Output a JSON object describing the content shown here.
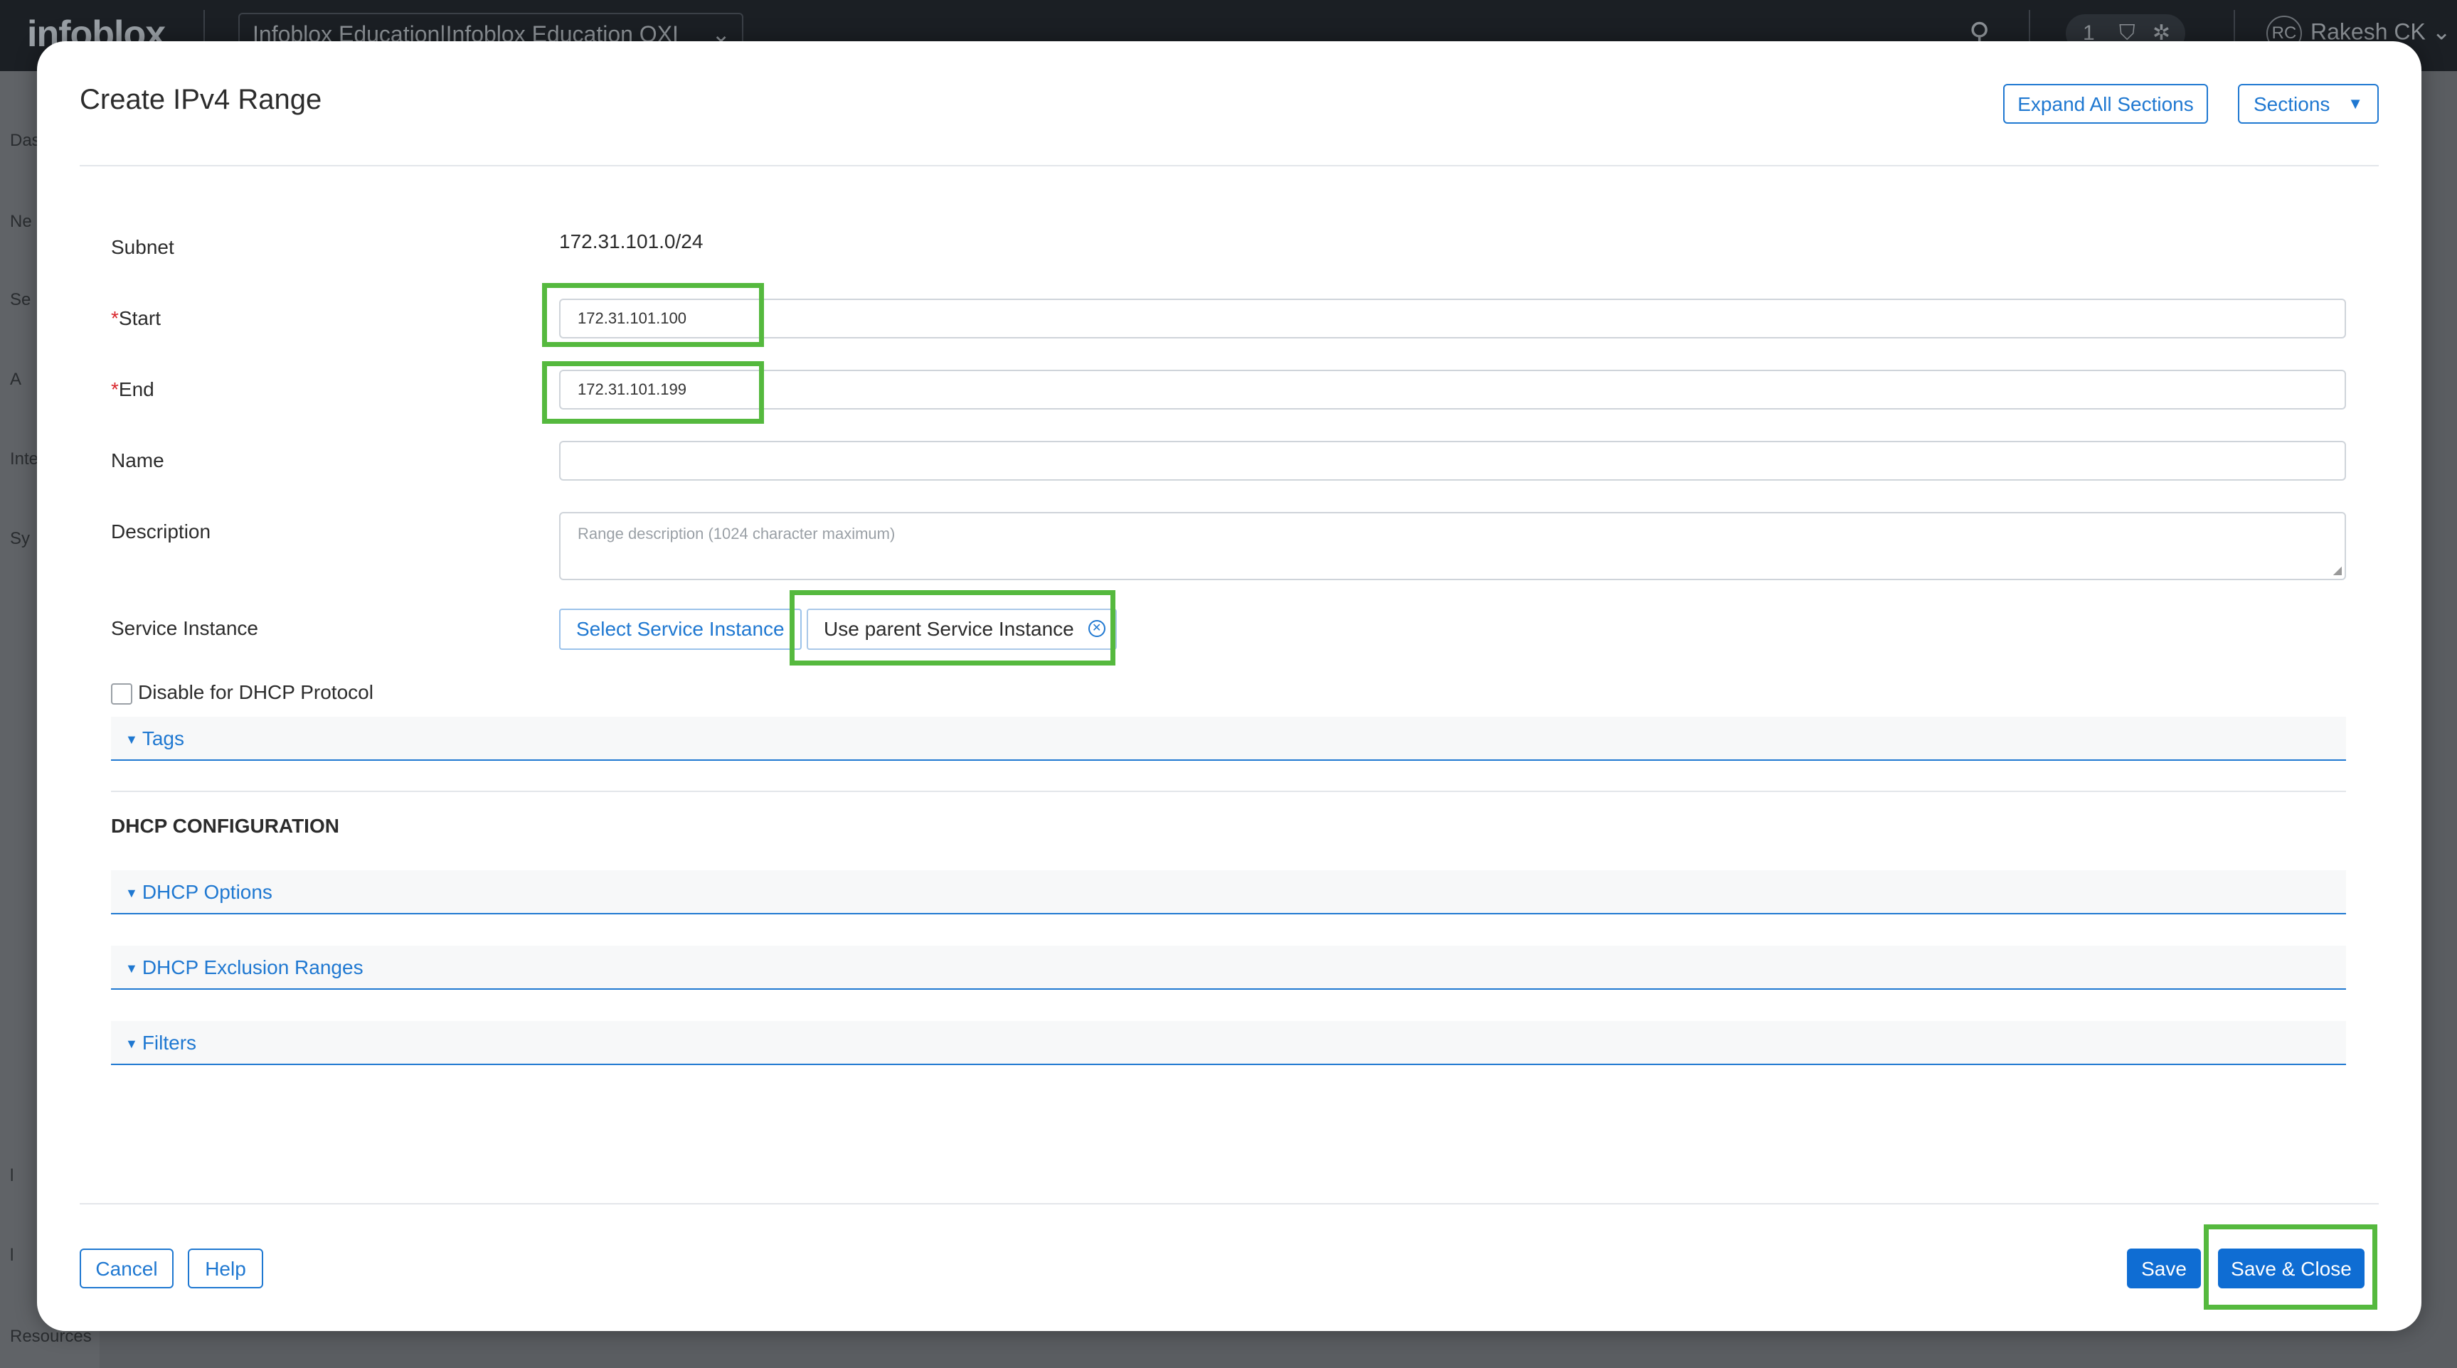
{
  "app": {
    "logo": "infoblox",
    "org_selector": "Infoblox Education|Infoblox Education OXI",
    "notification_count": "1",
    "user_initials": "RC",
    "user_name": "Rakesh CK",
    "sidebar_items": [
      "Das",
      "Ne",
      "Se",
      "A",
      "Inte",
      "Sy",
      "l",
      "l"
    ],
    "sidebar_bottom": "Resources"
  },
  "modal": {
    "title": "Create IPv4 Range",
    "expand_all_label": "Expand All Sections",
    "sections_label": "Sections"
  },
  "form": {
    "subnet_label": "Subnet",
    "subnet_value": "172.31.101.0/24",
    "start_label": "Start",
    "start_value": "172.31.101.100",
    "end_label": "End",
    "end_value": "172.31.101.199",
    "name_label": "Name",
    "name_value": "",
    "description_label": "Description",
    "description_placeholder": "Range description (1024 character maximum)",
    "service_instance_label": "Service Instance",
    "select_service_instance": "Select Service Instance",
    "use_parent_service_instance": "Use parent Service Instance",
    "disable_dhcp_label": "Disable for DHCP Protocol",
    "disable_dhcp_checked": false
  },
  "sections": {
    "tags": "Tags",
    "dhcp_heading": "DHCP CONFIGURATION",
    "dhcp_options": "DHCP Options",
    "dhcp_exclusion_ranges": "DHCP Exclusion Ranges",
    "filters": "Filters"
  },
  "footer": {
    "cancel_label": "Cancel",
    "help_label": "Help",
    "save_label": "Save",
    "save_close_label": "Save & Close"
  },
  "colors": {
    "accent": "#1f78d1",
    "primary_button": "#0f6dd3",
    "highlight": "#55b93e",
    "required": "#d9262c"
  }
}
